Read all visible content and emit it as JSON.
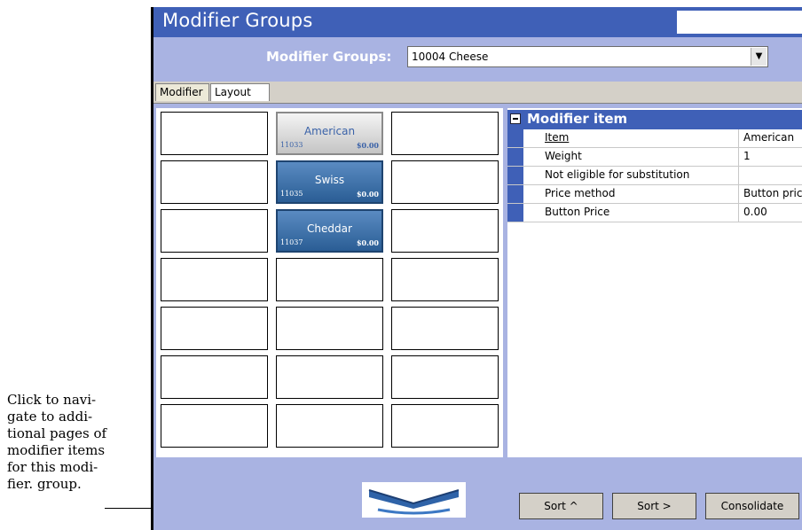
{
  "callout": {
    "lines": [
      "Click to navi-",
      "gate to addi-",
      "tional pages of",
      "modifier items",
      "for this modi-",
      "fier. group."
    ]
  },
  "window": {
    "title": "Modifier Groups"
  },
  "selector": {
    "label": "Modifier Groups:",
    "value": "10004 Cheese"
  },
  "tabs": [
    {
      "label": "Modifier"
    },
    {
      "label": "Layout"
    }
  ],
  "grid": {
    "buttons": [
      {
        "name": "American",
        "code": "11033",
        "price": "$0.00",
        "style": "silver"
      },
      {
        "name": "Swiss",
        "code": "11035",
        "price": "$0.00",
        "style": "blue"
      },
      {
        "name": "Cheddar",
        "code": "11037",
        "price": "$0.00",
        "style": "blue"
      }
    ]
  },
  "properties": {
    "title": "Modifier item",
    "rows": [
      {
        "name": "Item",
        "value": "American"
      },
      {
        "name": "Weight",
        "value": "1"
      },
      {
        "name": "Not eligible for substitution",
        "value": ""
      },
      {
        "name": "Price method",
        "value": "Button price"
      },
      {
        "name": "Button Price",
        "value": "0.00"
      }
    ]
  },
  "footer": {
    "sort_up_label": "Sort ^",
    "sort_right_label": "Sort >",
    "consolidate_label": "Consolidate"
  },
  "colors": {
    "titlebar": "#3f60b7",
    "panel_bg": "#a9b3e2",
    "button_blue": "#3d72ad"
  },
  "icons": {
    "nav": "chevron-down-icon",
    "collapse": "minus-box-icon",
    "dropdown": "triangle-down-icon"
  }
}
